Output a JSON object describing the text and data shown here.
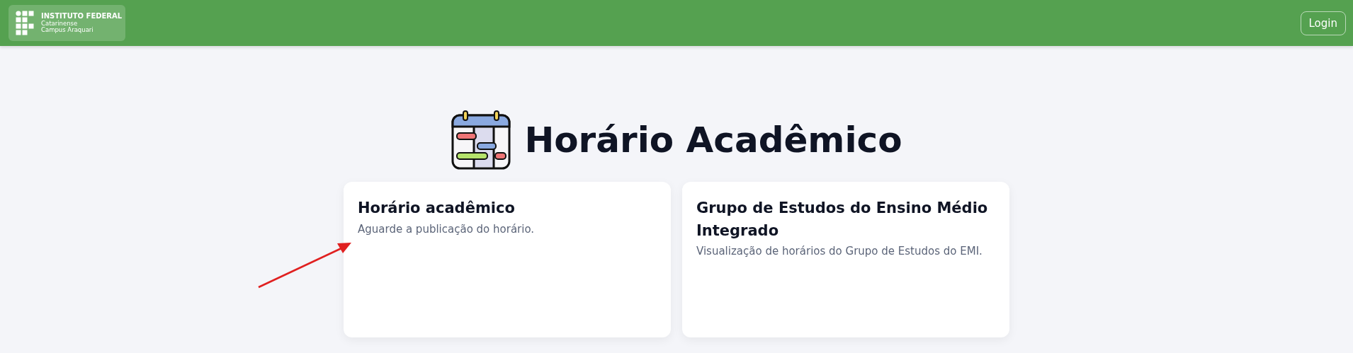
{
  "header": {
    "logo": {
      "name": "INSTITUTO FEDERAL",
      "line_1": "Catarinense",
      "line_2": "Campus Araquari"
    },
    "login_button": "Login"
  },
  "title": "Horário Acadêmico",
  "cards": [
    {
      "title": "Horário acadêmico",
      "description": "Aguarde a publicação do horário."
    },
    {
      "title": "Grupo de Estudos do Ensino Médio Integrado",
      "description": "Visualização de horários do Grupo de Estudos do EMI."
    }
  ],
  "annotation": {
    "kind": "arrow"
  }
}
